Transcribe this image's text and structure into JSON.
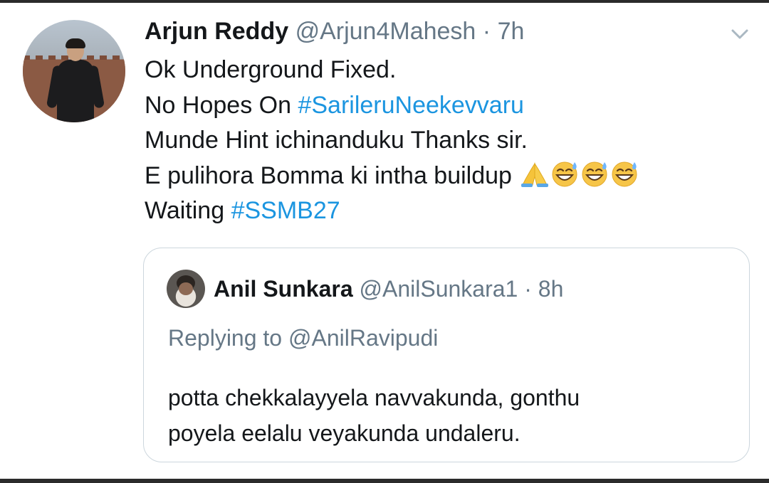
{
  "tweet": {
    "author_name": "Arjun Reddy",
    "handle": "@Arjun4Mahesh",
    "separator": "·",
    "time": "7h",
    "lines": [
      [
        "Ok Underground Fixed."
      ],
      [
        "No Hopes On ",
        "#SarileruNeekevvaru"
      ],
      [
        "Munde Hint ichinanduku Thanks sir."
      ],
      [
        "E pulihora Bomma ki intha buildup "
      ],
      [
        "Waiting ",
        "#SSMB27"
      ]
    ],
    "emojis": [
      "folded-hands-emoji",
      "grinning-sweat-emoji",
      "grinning-sweat-emoji",
      "grinning-sweat-emoji"
    ]
  },
  "quoted_tweet": {
    "author_name": "Anil Sunkara",
    "handle": "@AnilSunkara1",
    "separator": "·",
    "time": "8h",
    "replying_to": "Replying to @AnilRavipudi",
    "body_lines": [
      "potta chekkalayyela navvakunda, gonthu",
      "poyela eelalu veyakunda undaleru."
    ]
  },
  "colors": {
    "text": "#14171a",
    "secondary": "#657786",
    "link": "#1b95e0",
    "border": "#ccd6dd"
  },
  "icons": {
    "more_menu": "chevron-down-icon"
  }
}
